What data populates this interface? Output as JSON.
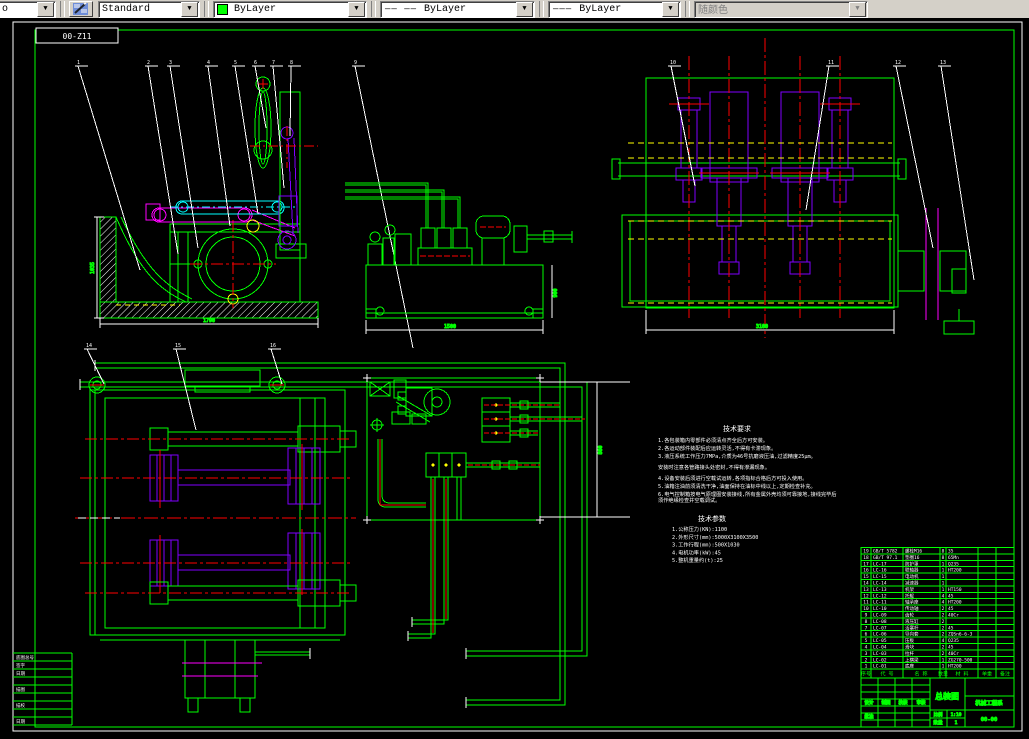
{
  "toolbar": {
    "partial_fragment": "o",
    "style_value": "Standard",
    "color_value": "ByLayer",
    "linetype_value": "ByLayer",
    "lineweight_value": "ByLayer",
    "plotstyle_value": "随颜色",
    "color_swatch": "#00ff00"
  },
  "sheet": {
    "label_code": "00-Z11"
  },
  "colors": {
    "outline": "#00ff00",
    "centerline": "#ff0000",
    "mechanism": "#7f00ff",
    "lever": "#ff00ff",
    "lever2": "#00ffff",
    "phantom": "#ffff00",
    "annotation": "#ffffff"
  },
  "callouts": {
    "a": [
      "1",
      "2",
      "3",
      "4",
      "5",
      "6",
      "7",
      "8",
      "9"
    ],
    "c": [
      "10",
      "11",
      "12",
      "13"
    ],
    "d": [
      "14",
      "15",
      "16"
    ]
  },
  "dims": {
    "a_bottom": "1790",
    "a_left": "1035",
    "b_bottom": "1500",
    "b_right": "900",
    "c_bottom": "3100",
    "e_right": "860"
  },
  "notes1": {
    "title": "技术要求",
    "lines": [
      "1.各包装箱内零部件必须清点齐全后方可安装。",
      "2.各运动部件装配后应运转灵活,不得有卡滞现象。",
      "3.液压系统工作压力7MPa,介质为46号抗磨液压油,过滤精度25μm。",
      "安装时注意各管路接头处密封,不得有渗漏现象。",
      "4.设备安装后须进行空载试运转,各项指标合格后方可投入使用。",
      "5.油箱注油前须清洗干净,油面保持在油标中线以上,定期检查补充。",
      "6.电气控制箱按电气原理图安装接线,所有金属外壳均须可靠接地,接线完毕后",
      "须作绝缘检查并空载调试。"
    ]
  },
  "notes2": {
    "title": "技术参数",
    "lines": [
      "1.公称压力(KN):1100",
      "2.外形尺寸(mm):5000X3100X3500",
      "3.工作行程(mm):500X1030",
      "4.电机功率(kW):45",
      "5.整机重量约(t):25"
    ]
  },
  "bom": {
    "headers": [
      "序号",
      "代  号",
      "名  称",
      "数量",
      "材  料",
      "单重",
      "备注"
    ],
    "rows": [
      {
        "no": "19",
        "code": "GB/T 5782",
        "name": "螺栓M16",
        "qty": "8",
        "mat": "35"
      },
      {
        "no": "18",
        "code": "GB/T 97.1",
        "name": "垫圈16",
        "qty": "8",
        "mat": "65Mn"
      },
      {
        "no": "17",
        "code": "LC-17",
        "name": "防护罩",
        "qty": "1",
        "mat": "Q235"
      },
      {
        "no": "16",
        "code": "LC-16",
        "name": "联轴器",
        "qty": "1",
        "mat": "HT200"
      },
      {
        "no": "15",
        "code": "LC-15",
        "name": "电动机",
        "qty": "1",
        "mat": ""
      },
      {
        "no": "14",
        "code": "LC-14",
        "name": "减速器",
        "qty": "1",
        "mat": ""
      },
      {
        "no": "13",
        "code": "LC-13",
        "name": "机架",
        "qty": "1",
        "mat": "HT150"
      },
      {
        "no": "12",
        "code": "LC-12",
        "name": "托辊",
        "qty": "4",
        "mat": "45"
      },
      {
        "no": "11",
        "code": "LC-11",
        "name": "轴承座",
        "qty": "4",
        "mat": "HT200"
      },
      {
        "no": "10",
        "code": "LC-10",
        "name": "传动轴",
        "qty": "2",
        "mat": "45"
      },
      {
        "no": "9",
        "code": "LC-09",
        "name": "齿轮",
        "qty": "2",
        "mat": "40Cr"
      },
      {
        "no": "8",
        "code": "LC-08",
        "name": "液压缸",
        "qty": "2",
        "mat": ""
      },
      {
        "no": "7",
        "code": "LC-07",
        "name": "活塞杆",
        "qty": "2",
        "mat": "45"
      },
      {
        "no": "6",
        "code": "LC-06",
        "name": "导向套",
        "qty": "2",
        "mat": "ZQSn6-6-3"
      },
      {
        "no": "5",
        "code": "LC-05",
        "name": "压板",
        "qty": "4",
        "mat": "Q235"
      },
      {
        "no": "4",
        "code": "LC-04",
        "name": "滑块",
        "qty": "2",
        "mat": "45"
      },
      {
        "no": "3",
        "code": "LC-03",
        "name": "拉杆",
        "qty": "2",
        "mat": "40Cr"
      },
      {
        "no": "2",
        "code": "LC-02",
        "name": "上横梁",
        "qty": "1",
        "mat": "ZG270-500"
      },
      {
        "no": "1",
        "code": "LC-01",
        "name": "底座",
        "qty": "1",
        "mat": "HT200"
      }
    ]
  },
  "titleblock": {
    "drawing_title": "总装图",
    "org": "机械工程系",
    "drawing_no": "00-00",
    "scale_label": "比例",
    "scale": "1:10",
    "qty_label": "数量",
    "qty": "1",
    "fields": [
      "设计",
      "制图",
      "校核",
      "审核"
    ],
    "approve": "批准"
  },
  "revision": {
    "rows": [
      "底图总号",
      "签字",
      "日期",
      "",
      "描图",
      "",
      "描校",
      "",
      "日期"
    ]
  }
}
